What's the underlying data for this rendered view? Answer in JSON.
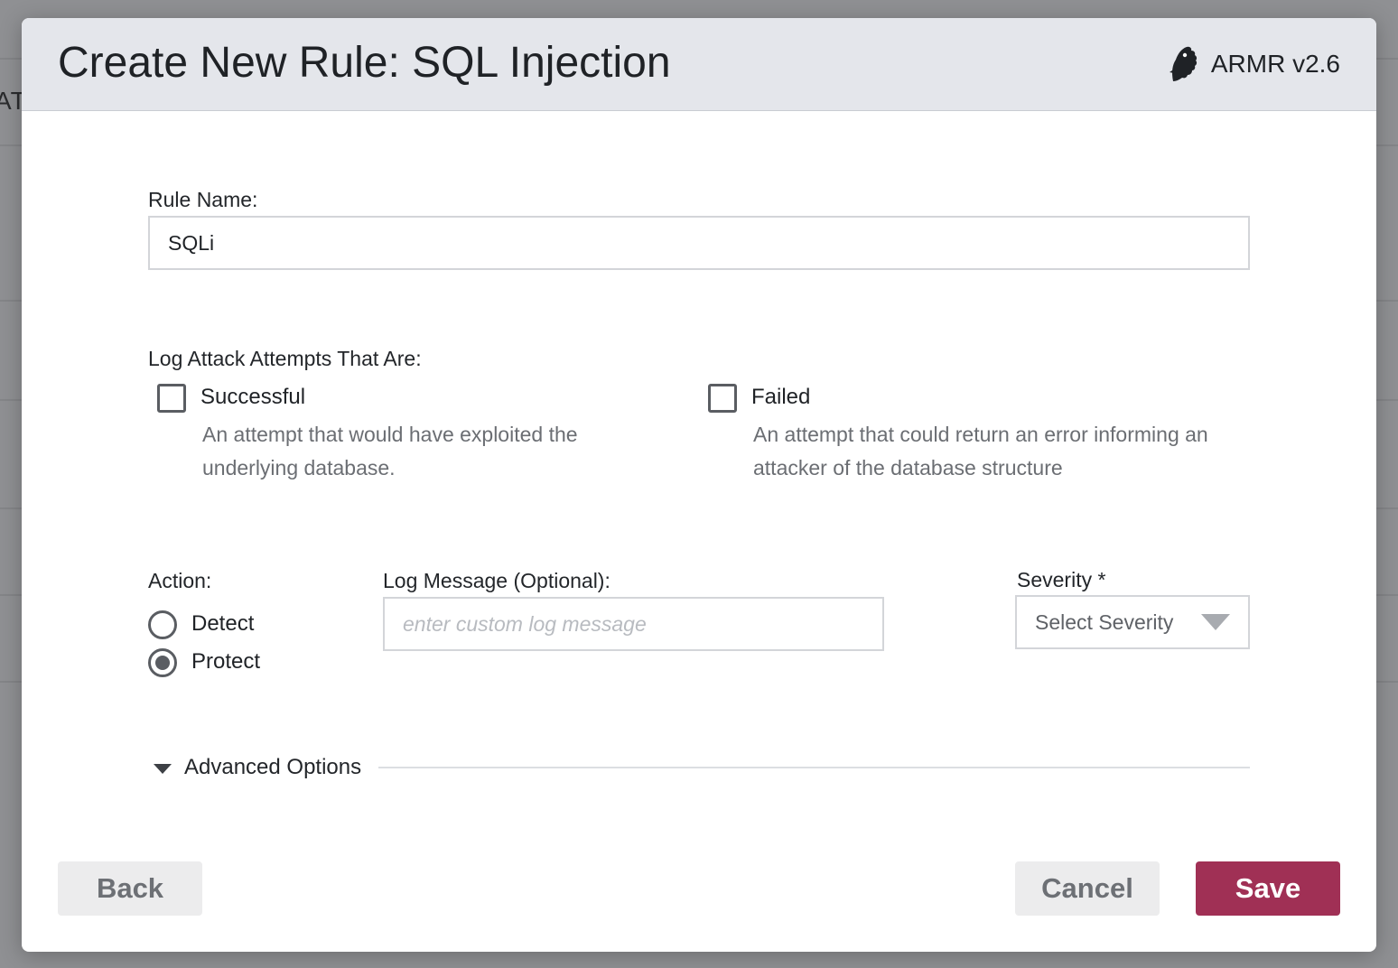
{
  "background": {
    "partial_text": "AT"
  },
  "modal": {
    "title": "Create New Rule: SQL Injection",
    "brand": {
      "name": "ARMR v2.6",
      "logo_icon": "bird-head-icon"
    }
  },
  "form": {
    "rule_name": {
      "label": "Rule Name:",
      "value": "SQLi"
    },
    "log_attempts": {
      "label": "Log Attack Attempts That Are:",
      "options": [
        {
          "label": "Successful",
          "checked": false,
          "description": "An attempt that would have exploited the underlying database."
        },
        {
          "label": "Failed",
          "checked": false,
          "description": "An attempt that could return an error informing an attacker of the database structure"
        }
      ]
    },
    "action": {
      "label": "Action:",
      "options": [
        {
          "label": "Detect",
          "selected": false
        },
        {
          "label": "Protect",
          "selected": true
        }
      ]
    },
    "log_message": {
      "label": "Log Message (Optional):",
      "value": "",
      "placeholder": "enter custom log message"
    },
    "severity": {
      "label": "Severity *",
      "selected": "Select Severity"
    },
    "advanced": {
      "label": "Advanced Options",
      "expanded": true
    }
  },
  "buttons": {
    "back": "Back",
    "cancel": "Cancel",
    "save": "Save"
  },
  "colors": {
    "primary": "#a03055",
    "header_bg": "#e4e6eb",
    "secondary_btn_bg": "#ececed"
  }
}
